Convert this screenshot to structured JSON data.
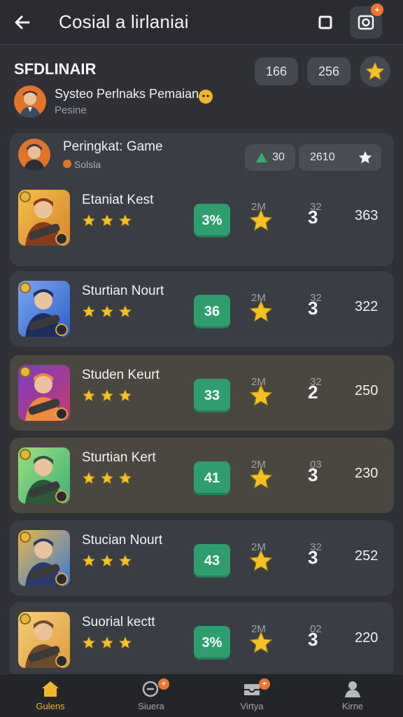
{
  "header": {
    "title": "Cosial a lirlaniai"
  },
  "summary": {
    "section_title": "SFDLINAIR",
    "pill_a": "166",
    "pill_b": "256",
    "user_name": "Systeo Perlnaks Pemaian",
    "user_sub": "Pesine"
  },
  "card": {
    "title": "Peringkat: Game",
    "subtitle": "Solsla",
    "up_value": "30",
    "score_value": "2610"
  },
  "games": [
    {
      "name": "Etaniat Kest",
      "score": "3%",
      "label_a": "2M",
      "label_b": "32",
      "rank": "3",
      "points": "363",
      "stars": 3
    },
    {
      "name": "Sturtian Nourt",
      "score": "36",
      "label_a": "2M",
      "label_b": "32",
      "rank": "3",
      "points": "322",
      "stars": 3
    },
    {
      "name": "Studen Keurt",
      "score": "33",
      "label_a": "2M",
      "label_b": "32",
      "rank": "2",
      "points": "250",
      "stars": 3
    },
    {
      "name": "Sturtian Kert",
      "score": "41",
      "label_a": "2M",
      "label_b": "03",
      "rank": "3",
      "points": "230",
      "stars": 3
    },
    {
      "name": "Stucian Nourt",
      "score": "43",
      "label_a": "2M",
      "label_b": "32",
      "rank": "3",
      "points": "252",
      "stars": 3
    },
    {
      "name": "Suorial kectt",
      "score": "3%",
      "label_a": "2M",
      "label_b": "02",
      "rank": "3",
      "points": "220",
      "stars": 3
    }
  ],
  "nav": [
    {
      "label": "Gulens",
      "icon": "home-icon"
    },
    {
      "label": "Siuera",
      "icon": "chat-icon"
    },
    {
      "label": "Virtya",
      "icon": "inbox-icon"
    },
    {
      "label": "Kirne",
      "icon": "profile-icon"
    }
  ],
  "colors": {
    "background": "#2f3136",
    "card": "#3a3d43",
    "accent_green": "#2f9e6e",
    "star_gold": "#f4c21f",
    "badge_orange": "#f0742b",
    "active_nav": "#f1b52a"
  }
}
